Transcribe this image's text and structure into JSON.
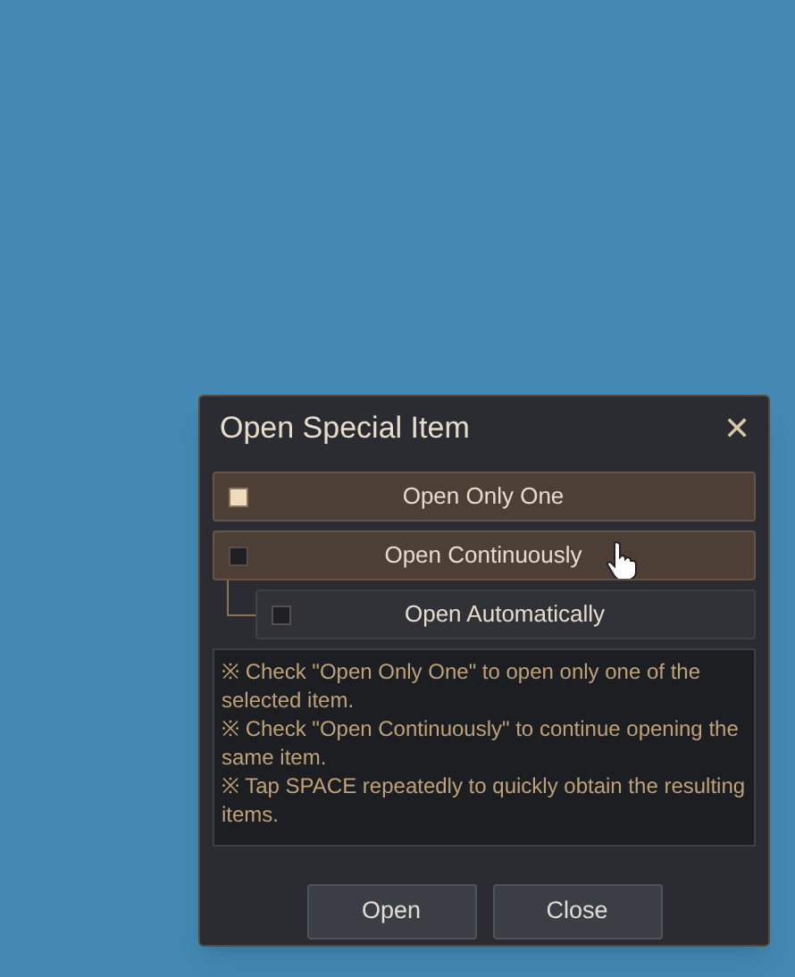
{
  "dialog": {
    "title": "Open Special Item",
    "close_glyph": "✕"
  },
  "options": [
    {
      "label": "Open Only One",
      "checked": true,
      "active": true
    },
    {
      "label": "Open Continuously",
      "checked": false,
      "active": true,
      "children": [
        {
          "label": "Open Automatically",
          "checked": false,
          "active": false
        }
      ]
    }
  ],
  "notes": [
    "※ Check \"Open Only One\" to open only one of the selected item.",
    "※ Check \"Open Continuously\" to continue opening the same item.",
    "※ Tap SPACE repeatedly to quickly obtain the resulting items."
  ],
  "buttons": [
    "Open",
    "Close"
  ]
}
